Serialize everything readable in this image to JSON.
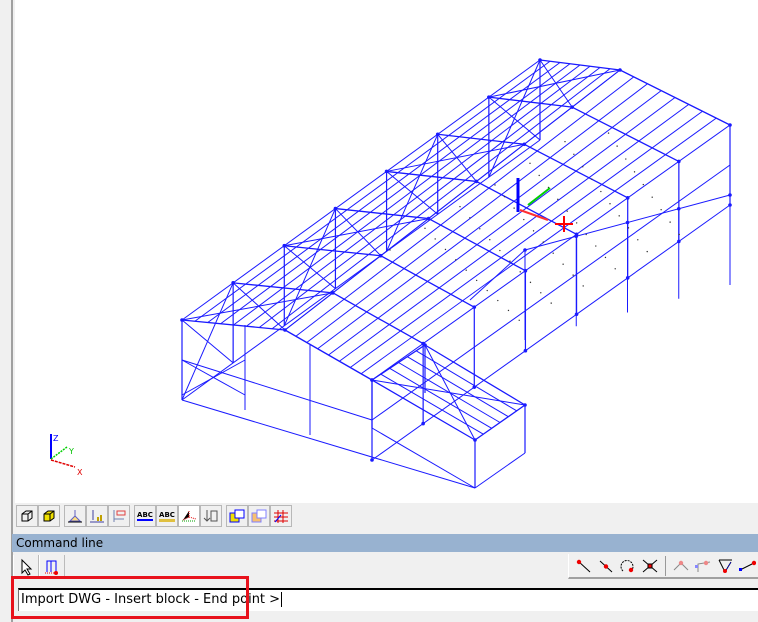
{
  "viewport": {
    "axis_labels": {
      "x": "X",
      "y": "Y",
      "z": "Z"
    }
  },
  "toolbar": {
    "buttons": [
      {
        "icon": "wireframe-solid-icon"
      },
      {
        "icon": "solid-render-icon"
      },
      {
        "icon": "support-icon"
      },
      {
        "icon": "load-diagram-icon"
      },
      {
        "icon": "result-diagram-icon"
      },
      {
        "icon": "abc-label-member-icon",
        "label": "ABC"
      },
      {
        "icon": "abc-label-solid-icon",
        "label": "ABC"
      },
      {
        "icon": "node-display-icon"
      },
      {
        "icon": "import-list-icon"
      },
      {
        "icon": "table-view-icon"
      },
      {
        "icon": "table-view-alt-icon"
      },
      {
        "icon": "grid-view-icon"
      }
    ]
  },
  "command_line": {
    "title": "Command line",
    "input_value": "Import DWG - Insert block - End point >",
    "buttons": [
      {
        "icon": "select-arrow-icon"
      },
      {
        "icon": "insert-block-icon"
      }
    ],
    "snaps": [
      {
        "icon": "snap-endpoint-icon"
      },
      {
        "icon": "snap-midpoint-icon"
      },
      {
        "icon": "snap-center-icon"
      },
      {
        "icon": "snap-intersection-icon"
      },
      {
        "icon": "snap-apex-icon"
      },
      {
        "icon": "snap-perpendicular-icon"
      },
      {
        "icon": "snap-tangent-icon"
      },
      {
        "icon": "snap-nearest-icon"
      }
    ]
  },
  "colors": {
    "structure": "#1a1aff",
    "highlight": "#e8121c",
    "header": "#98b2d0"
  }
}
